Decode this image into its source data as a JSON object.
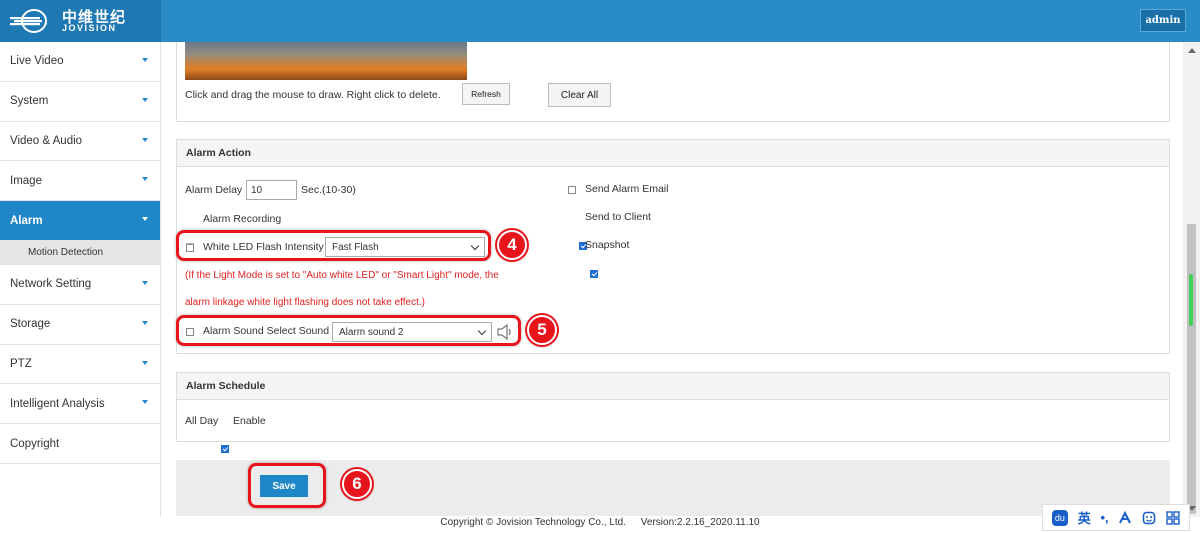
{
  "header": {
    "logo_cn": "中维世纪",
    "logo_en": "JOVISION",
    "user_label": "admin",
    "bar_color": "#2a8cc6"
  },
  "sidebar": {
    "items": [
      {
        "label": "Live Video"
      },
      {
        "label": "System"
      },
      {
        "label": "Video & Audio"
      },
      {
        "label": "Image"
      },
      {
        "label": "Alarm",
        "active": true
      },
      {
        "label": "Network Setting"
      },
      {
        "label": "Storage"
      },
      {
        "label": "PTZ"
      },
      {
        "label": "Intelligent Analysis"
      },
      {
        "label": "Copyright"
      }
    ],
    "sub_item": "Motion Detection"
  },
  "detection_area": {
    "hint": "Click and drag the mouse to draw. Right click to delete.",
    "refresh_label": "Refresh",
    "clear_label": "Clear All"
  },
  "alarm_action": {
    "title": "Alarm Action",
    "delay_label": "Alarm Delay",
    "delay_value": "10",
    "delay_unit": "Sec.(10-30)",
    "recording_label": "Alarm Recording",
    "white_led_label": "White LED Flash Intensity",
    "white_led_value": "Fast Flash",
    "warning_line1": "(If the Light Mode is set to \"Auto white LED\" or \"Smart Light\" mode, the",
    "warning_line2": "alarm linkage white light flashing does not take effect.)",
    "sound_label": "Alarm Sound Select Sound",
    "sound_value": "Alarm sound 2",
    "send_email_label": "Send Alarm Email",
    "send_client_label": "Send to Client",
    "snapshot_label": "Snapshot",
    "checked": {
      "alarm_recording": true,
      "white_led": false,
      "alarm_sound": false,
      "send_email": false,
      "send_client": true,
      "snapshot": true
    }
  },
  "alarm_schedule": {
    "title": "Alarm Schedule",
    "all_day_label": "All Day",
    "enable_label": "Enable",
    "enabled": true
  },
  "save_label": "Save",
  "annotations": {
    "step4": "4",
    "step5": "5",
    "step6": "6",
    "color": "#e8141b"
  },
  "footer": {
    "copyright": "Copyright © Jovision Technology Co., Ltd.",
    "version": "Version:2.2.16_2020.11.10"
  },
  "ime": {
    "lang": "英",
    "punct": "•,"
  }
}
